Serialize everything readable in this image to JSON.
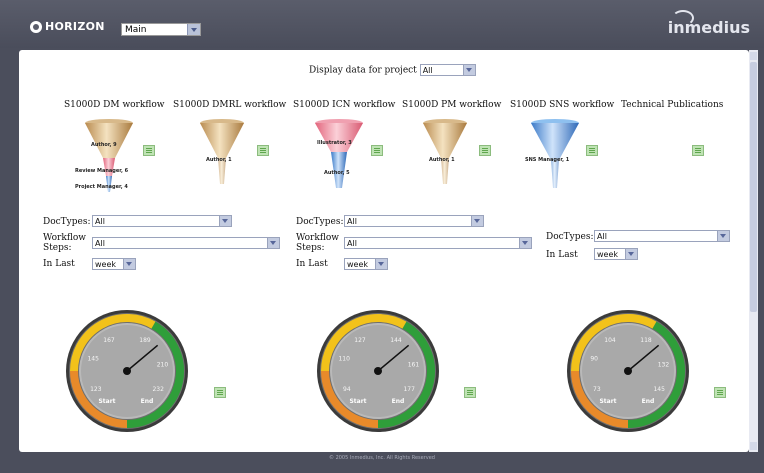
{
  "header": {
    "logo_text": "HORIZON",
    "view_select": "Main",
    "brand_text": "inmedius"
  },
  "project_filter": {
    "label": "Display data for project",
    "value": "All"
  },
  "workflows": [
    {
      "title": "S1000D DM workflow",
      "labels": [
        "Author, 9",
        "Review Manager, 6",
        "Project Manager, 4"
      ]
    },
    {
      "title": "S1000D DMRL workflow",
      "labels": [
        "Author, 1"
      ]
    },
    {
      "title": "S1000D ICN workflow",
      "labels": [
        "Illustrator, 3",
        "Author, 5"
      ]
    },
    {
      "title": "S1000D PM workflow",
      "labels": [
        "Author, 1"
      ]
    },
    {
      "title": "S1000D SNS workflow",
      "labels": [
        "SNS Manager, 1"
      ]
    },
    {
      "title": "Technical Publications",
      "labels": []
    }
  ],
  "filter_panels": [
    {
      "doctypes_label": "DocTypes:",
      "doctypes_value": "All",
      "steps_label": "Workflow Steps:",
      "steps_value": "All",
      "inlast_label": "In Last",
      "inlast_value": "week"
    },
    {
      "doctypes_label": "DocTypes:",
      "doctypes_value": "All",
      "steps_label": "Workflow Steps:",
      "steps_value": "All",
      "inlast_label": "In Last",
      "inlast_value": "week"
    },
    {
      "doctypes_label": "DocTypes:",
      "doctypes_value": "All",
      "inlast_label": "In Last",
      "inlast_value": "week"
    }
  ],
  "gauges": [
    {
      "ticks": [
        "123",
        "145",
        "167",
        "189",
        "210",
        "232"
      ],
      "start_label": "Start",
      "end_label": "End"
    },
    {
      "ticks": [
        "94",
        "110",
        "127",
        "144",
        "161",
        "177"
      ],
      "start_label": "Start",
      "end_label": "End"
    },
    {
      "ticks": [
        "73",
        "90",
        "104",
        "118",
        "132",
        "145"
      ],
      "start_label": "Start",
      "end_label": "End"
    }
  ],
  "footer": {
    "copyright": "© 2005 Inmedius, Inc. All Rights Reserved"
  },
  "colors": {
    "frame": "#4b4e5c",
    "gauge_orange": "#e88a2a",
    "gauge_yellow": "#f2c21a",
    "gauge_green": "#2f9e3a"
  }
}
